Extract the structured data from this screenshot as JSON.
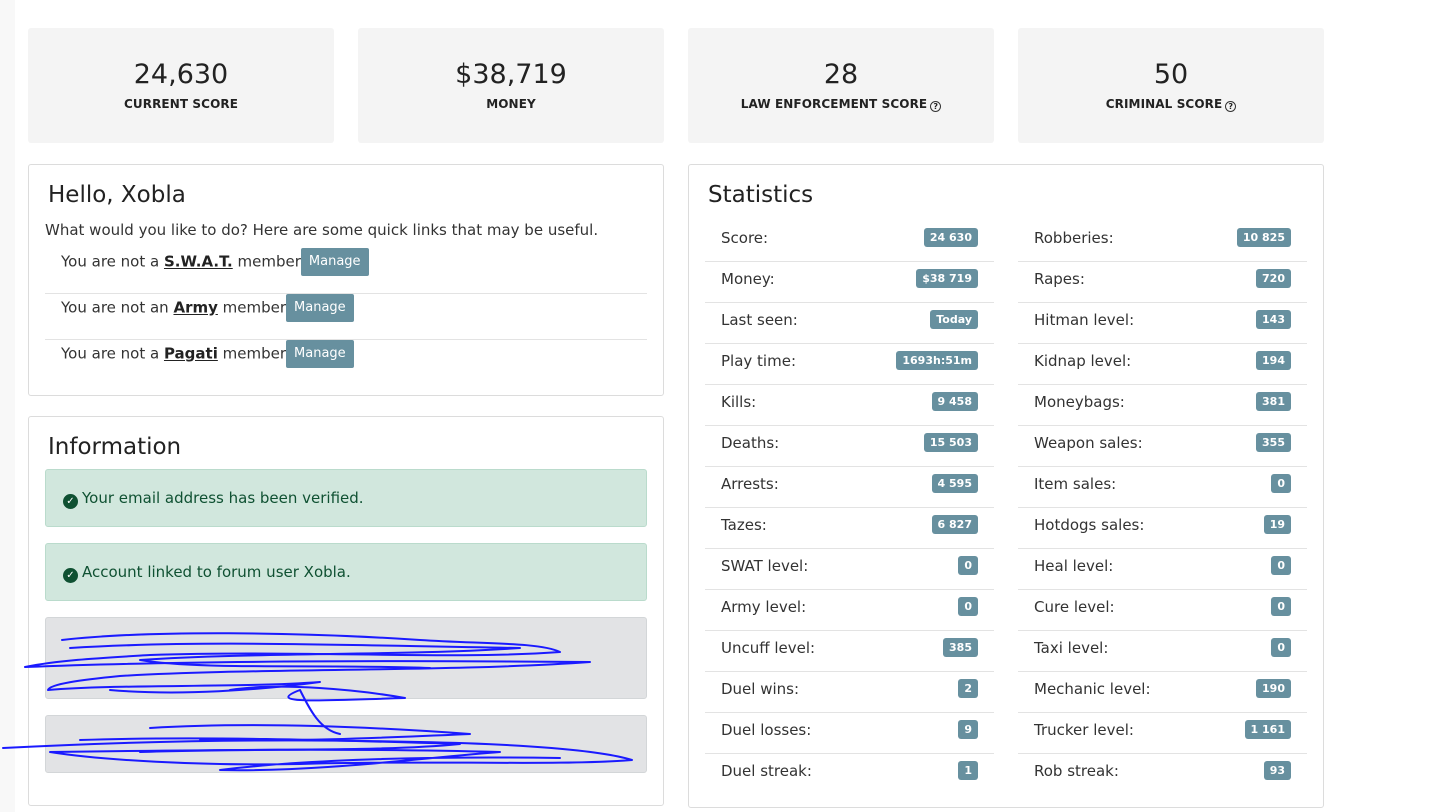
{
  "cards": [
    {
      "value": "24,630",
      "label": "CURRENT SCORE",
      "help": false
    },
    {
      "value": "$38,719",
      "label": "MONEY",
      "help": false
    },
    {
      "value": "28",
      "label": "LAW ENFORCEMENT SCORE",
      "help": true
    },
    {
      "value": "50",
      "label": "CRIMINAL SCORE",
      "help": true
    }
  ],
  "hello": {
    "title": "Hello, Xobla",
    "intro": "What would you like to do? Here are some quick links that may be useful.",
    "rows": [
      {
        "prefix": "You are not a",
        "group": "S.W.A.T.",
        "suffix": "member",
        "button": "Manage"
      },
      {
        "prefix": "You are not an",
        "group": "Army",
        "suffix": "member",
        "button": "Manage"
      },
      {
        "prefix": "You are not a",
        "group": "Pagati",
        "suffix": "member",
        "button": "Manage"
      }
    ]
  },
  "info": {
    "title": "Information",
    "alerts": [
      "Your email address has been verified.",
      "Account linked to forum user Xobla."
    ]
  },
  "stats": {
    "title": "Statistics",
    "left": [
      {
        "label": "Score:",
        "value": "24 630"
      },
      {
        "label": "Money:",
        "value": "$38 719"
      },
      {
        "label": "Last seen:",
        "value": "Today"
      },
      {
        "label": "Play time:",
        "value": "1693h:51m"
      },
      {
        "label": "Kills:",
        "value": "9 458"
      },
      {
        "label": "Deaths:",
        "value": "15 503"
      },
      {
        "label": "Arrests:",
        "value": "4 595"
      },
      {
        "label": "Tazes:",
        "value": "6 827"
      },
      {
        "label": "SWAT level:",
        "value": "0"
      },
      {
        "label": "Army level:",
        "value": "0"
      },
      {
        "label": "Uncuff level:",
        "value": "385"
      },
      {
        "label": "Duel wins:",
        "value": "2"
      },
      {
        "label": "Duel losses:",
        "value": "9"
      },
      {
        "label": "Duel streak:",
        "value": "1"
      }
    ],
    "right": [
      {
        "label": "Robberies:",
        "value": "10 825"
      },
      {
        "label": "Rapes:",
        "value": "720"
      },
      {
        "label": "Hitman level:",
        "value": "143"
      },
      {
        "label": "Kidnap level:",
        "value": "194"
      },
      {
        "label": "Moneybags:",
        "value": "381"
      },
      {
        "label": "Weapon sales:",
        "value": "355"
      },
      {
        "label": "Item sales:",
        "value": "0"
      },
      {
        "label": "Hotdogs sales:",
        "value": "19"
      },
      {
        "label": "Heal level:",
        "value": "0"
      },
      {
        "label": "Cure level:",
        "value": "0"
      },
      {
        "label": "Taxi level:",
        "value": "0"
      },
      {
        "label": "Mechanic level:",
        "value": "190"
      },
      {
        "label": "Trucker level:",
        "value": "1 161"
      },
      {
        "label": "Rob streak:",
        "value": "93"
      }
    ]
  },
  "colors": {
    "badge": "#67909f",
    "alert_bg": "#d1e7dd",
    "alert_text": "#0f5132",
    "scribble": "#1a1aff"
  }
}
